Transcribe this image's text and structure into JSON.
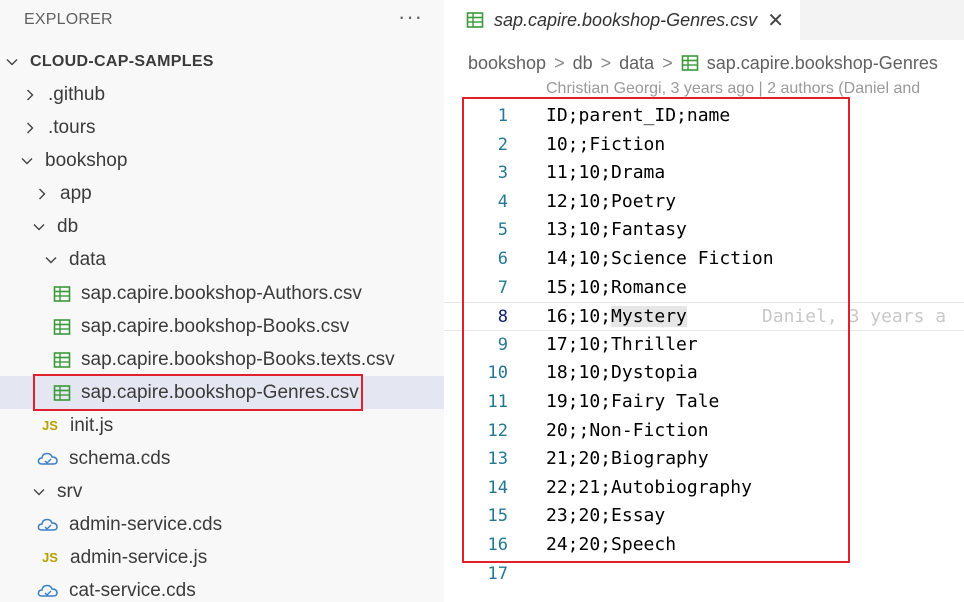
{
  "explorer": {
    "title": "EXPLORER",
    "more_icon": "ellipsis-icon",
    "project": "CLOUD-CAP-SAMPLES",
    "items": [
      {
        "label": ".github",
        "type": "folder",
        "expanded": false
      },
      {
        "label": ".tours",
        "type": "folder",
        "expanded": false
      },
      {
        "label": "bookshop",
        "type": "folder",
        "expanded": true
      },
      {
        "label": "app",
        "type": "folder",
        "expanded": false
      },
      {
        "label": "db",
        "type": "folder",
        "expanded": true
      },
      {
        "label": "data",
        "type": "folder",
        "expanded": true
      },
      {
        "label": "sap.capire.bookshop-Authors.csv",
        "type": "csv"
      },
      {
        "label": "sap.capire.bookshop-Books.csv",
        "type": "csv"
      },
      {
        "label": "sap.capire.bookshop-Books.texts.csv",
        "type": "csv"
      },
      {
        "label": "sap.capire.bookshop-Genres.csv",
        "type": "csv",
        "selected": true
      },
      {
        "label": "init.js",
        "type": "js"
      },
      {
        "label": "schema.cds",
        "type": "cds"
      },
      {
        "label": "srv",
        "type": "folder",
        "expanded": true
      },
      {
        "label": "admin-service.cds",
        "type": "cds"
      },
      {
        "label": "admin-service.js",
        "type": "js"
      },
      {
        "label": "cat-service.cds",
        "type": "cds"
      }
    ]
  },
  "tab": {
    "label": "sap.capire.bookshop-Genres.csv",
    "close_glyph": "✕"
  },
  "breadcrumb": [
    "bookshop",
    "db",
    "data",
    "sap.capire.bookshop-Genres"
  ],
  "blame_header": "Christian Georgi, 3 years ago | 2 authors (Daniel and",
  "code": {
    "lines": [
      "ID;parent_ID;name",
      "10;;Fiction",
      "11;10;Drama",
      "12;10;Poetry",
      "13;10;Fantasy",
      "14;10;Science Fiction",
      "15;10;Romance",
      "16;10;Mystery",
      "17;10;Thriller",
      "18;10;Dystopia",
      "19;10;Fairy Tale",
      "20;;Non-Fiction",
      "21;20;Biography",
      "22;21;Autobiography",
      "23;20;Essay",
      "24;20;Speech",
      ""
    ],
    "line_numbers": [
      "1",
      "2",
      "3",
      "4",
      "5",
      "6",
      "7",
      "8",
      "9",
      "10",
      "11",
      "12",
      "13",
      "14",
      "15",
      "16",
      "17"
    ],
    "current_line": 8,
    "current_prefix": "16;10;",
    "current_word": "Mystery",
    "inline_blame": "Daniel, 3 years a"
  },
  "colors": {
    "highlight_border": "#e0202a",
    "csv_icon": "#3a9a3a",
    "js_icon": "#b8a000",
    "cds_icon": "#3b7fc4",
    "line_number": "#237893"
  }
}
